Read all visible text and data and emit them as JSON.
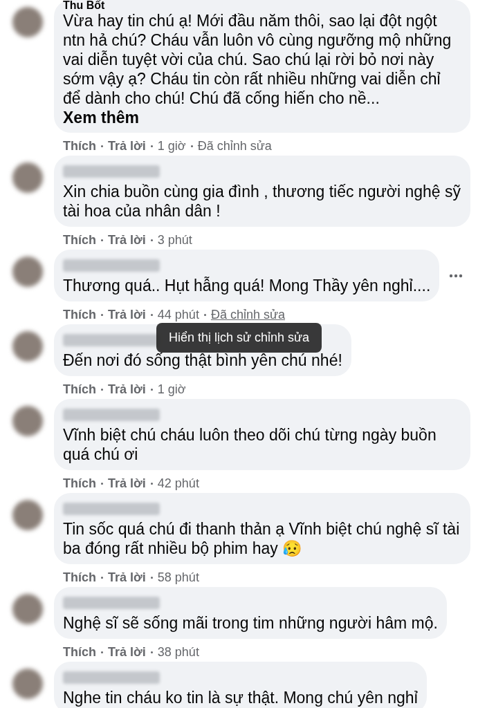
{
  "comments": [
    {
      "author": "Thu Bốt",
      "author_blurred": false,
      "text": "Vừa hay tin chú ạ! Mới đầu năm thôi, sao lại đột ngột ntn hả chú? Cháu vẫn luôn vô cùng ngưỡng mộ những vai diễn tuyệt vời của chú. Sao chú lại rời bỏ nơi này sớm vậy ạ? Cháu tin còn rất nhiều những vai diễn chỉ để dành cho chú! Chú đã cống hiến cho nề...",
      "see_more": "Xem thêm",
      "like": "Thích",
      "reply": "Trả lời",
      "time": "1 giờ",
      "edited": "Đã chỉnh sửa",
      "edited_hovered": false,
      "more_menu": false
    },
    {
      "author_blurred": true,
      "text": "Xin chia buồn cùng gia đình , thương tiếc người nghệ sỹ tài hoa của nhân dân !",
      "like": "Thích",
      "reply": "Trả lời",
      "time": "3 phút",
      "more_menu": false
    },
    {
      "author_blurred": true,
      "text": "Thương quá.. Hụt hẫng quá! Mong Thầy yên nghỉ....",
      "like": "Thích",
      "reply": "Trả lời",
      "time": "44 phút",
      "edited": "Đã chỉnh sửa",
      "edited_hovered": true,
      "tooltip": "Hiển thị lịch sử chỉnh sửa",
      "more_menu": true
    },
    {
      "author_blurred": true,
      "text": "Đến nơi đó sống thật bình yên chú nhé!",
      "like": "Thích",
      "reply": "Trả lời",
      "time": "1 giờ",
      "more_menu": false
    },
    {
      "author_blurred": true,
      "text": "Vĩnh biệt chú cháu luôn theo dõi chú từng ngày buồn quá chú ơi",
      "like": "Thích",
      "reply": "Trả lời",
      "time": "42 phút",
      "more_menu": false
    },
    {
      "author_blurred": true,
      "text": "Tin sốc quá chú đi thanh thản ạ Vĩnh biệt chú nghệ sĩ tài ba đóng rất nhiều bộ phim hay 😥",
      "like": "Thích",
      "reply": "Trả lời",
      "time": "58 phút",
      "more_menu": false
    },
    {
      "author_blurred": true,
      "text": "Nghệ sĩ sẽ sống mãi trong tim những người hâm mộ.",
      "like": "Thích",
      "reply": "Trả lời",
      "time": "38 phút",
      "more_menu": false
    },
    {
      "author_blurred": true,
      "text": "Nghe tin cháu ko tin là sự thật. Mong chú yên nghỉ",
      "more_menu": false
    }
  ]
}
